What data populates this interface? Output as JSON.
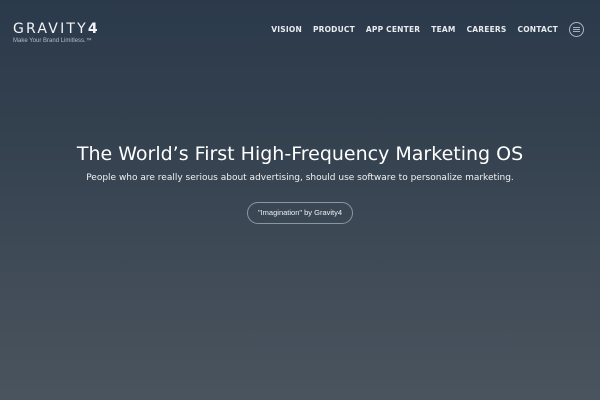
{
  "brand": {
    "name_text": "GRAVITY",
    "name_number": "4",
    "tagline": "Make Your Brand Limitless.™"
  },
  "nav": {
    "items": [
      {
        "label": "VISION"
      },
      {
        "label": "PRODUCT"
      },
      {
        "label": "APP CENTER"
      },
      {
        "label": "TEAM"
      },
      {
        "label": "CAREERS"
      },
      {
        "label": "CONTACT"
      }
    ],
    "menu_icon": "hamburger-menu-icon"
  },
  "hero": {
    "title": "The World’s First High-Frequency Marketing OS",
    "subtitle": "People who are really serious about advertising, should use software to personalize marketing.",
    "cta_label": "\"Imagination\" by Gravity4"
  },
  "colors": {
    "background_top": "#2b3a4b",
    "background_bottom": "#4a545e",
    "text": "#ffffff"
  }
}
